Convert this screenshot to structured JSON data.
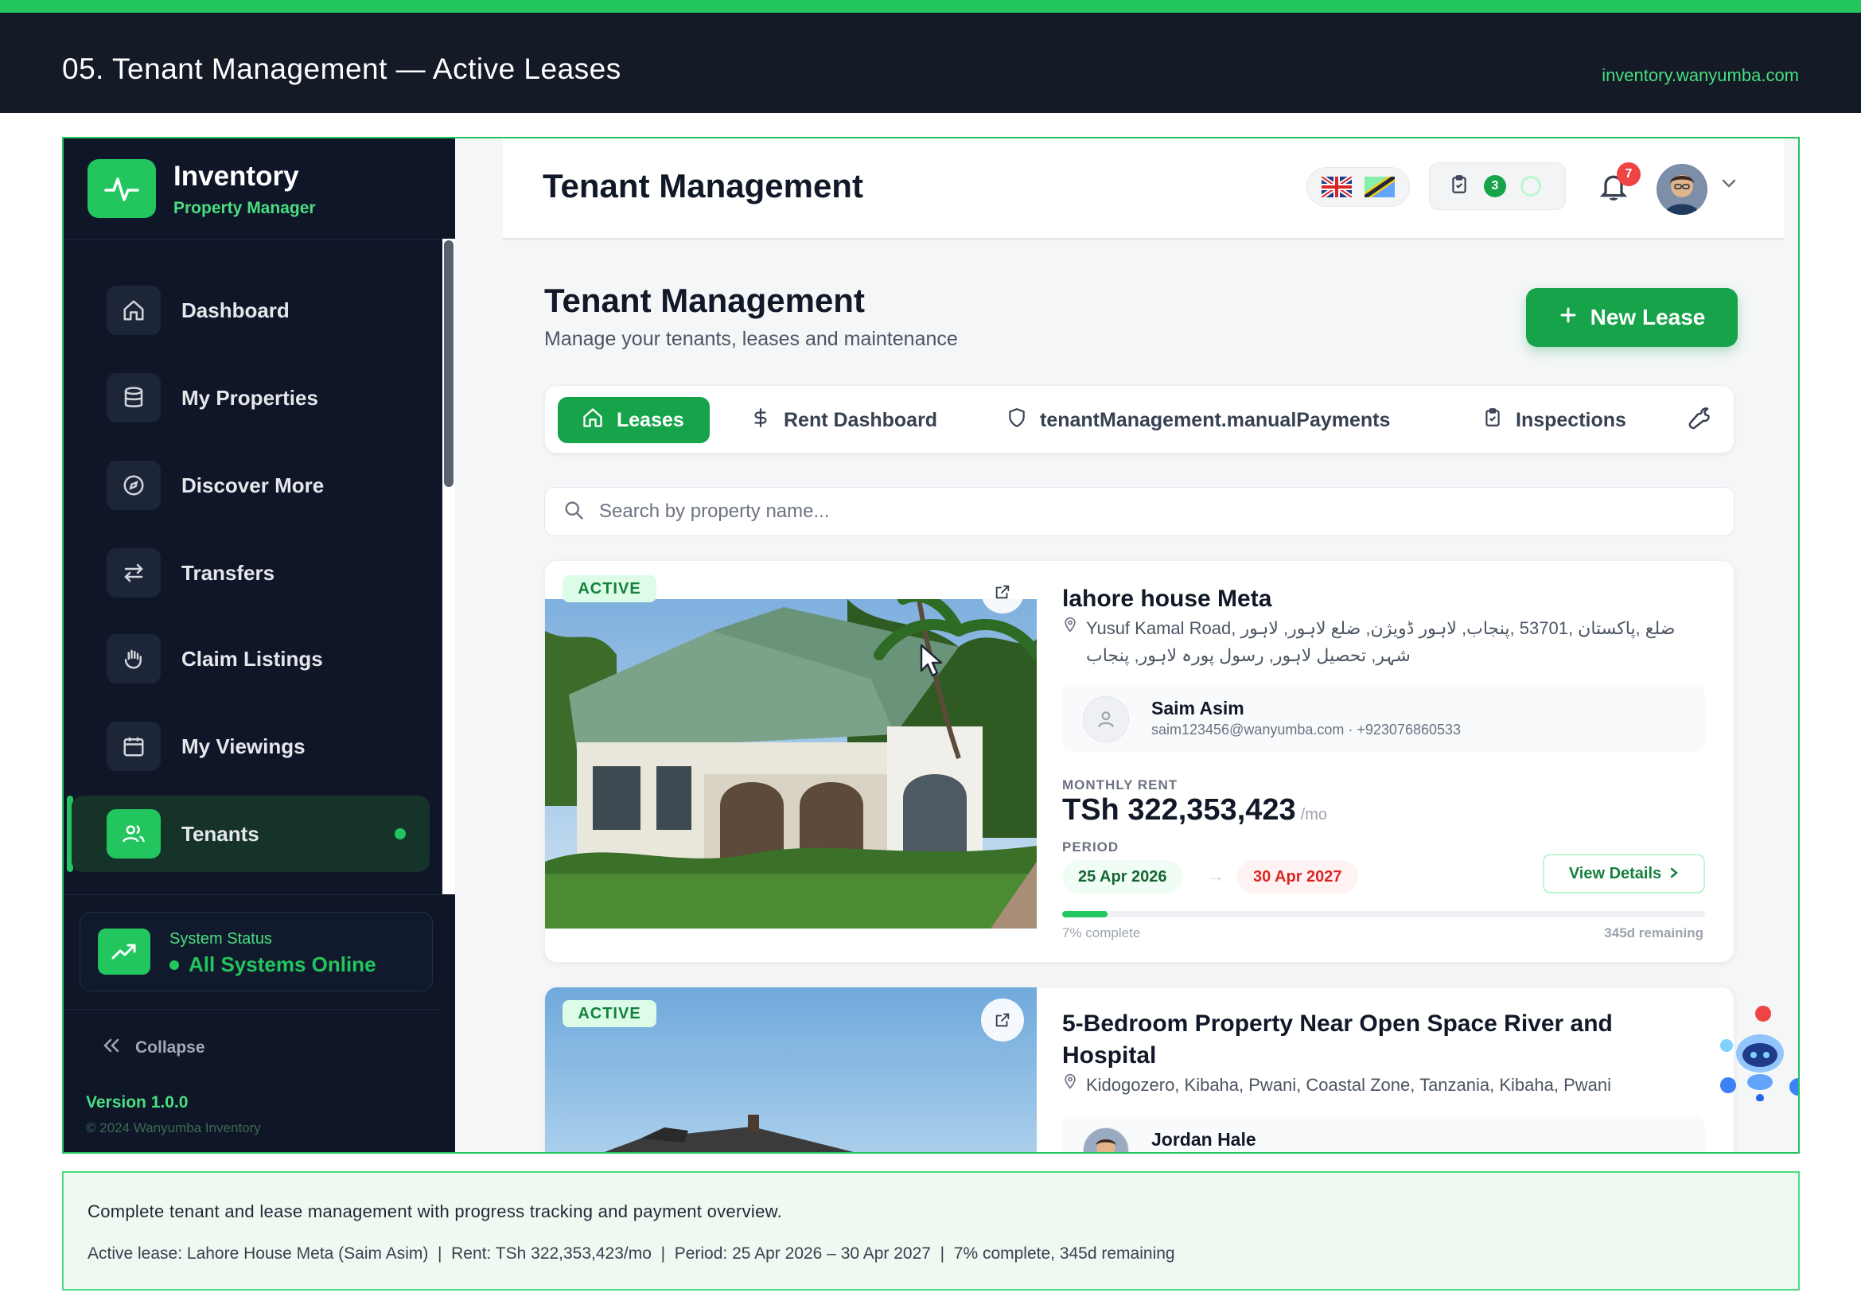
{
  "slide": {
    "title": "05. Tenant Management — Active Leases",
    "url": "inventory.wanyumba.com"
  },
  "sidebar": {
    "brand_name": "Inventory",
    "brand_sub": "Property Manager",
    "items": [
      {
        "label": "Dashboard",
        "icon": "home-icon"
      },
      {
        "label": "My Properties",
        "icon": "database-icon"
      },
      {
        "label": "Discover More",
        "icon": "compass-icon"
      },
      {
        "label": "Transfers",
        "icon": "transfer-arrows-icon"
      },
      {
        "label": "Claim Listings",
        "icon": "hand-icon"
      },
      {
        "label": "My Viewings",
        "icon": "calendar-icon"
      },
      {
        "label": "Tenants",
        "icon": "users-icon",
        "active": true
      }
    ],
    "status_title": "System Status",
    "status_value": "All Systems Online",
    "collapse_label": "Collapse",
    "version": "Version 1.0.0",
    "copyright": "© 2024 Wanyumba Inventory"
  },
  "header": {
    "title": "Tenant Management",
    "task_count": "3",
    "notification_count": "7"
  },
  "page": {
    "title": "Tenant Management",
    "subtitle": "Manage your tenants, leases and maintenance",
    "new_lease_label": "New Lease",
    "tabs": [
      {
        "label": "Leases",
        "icon": "home-icon"
      },
      {
        "label": "Rent Dashboard",
        "icon": "dollar-icon"
      },
      {
        "label": "tenantManagement.manualPayments",
        "icon": "shield-icon"
      },
      {
        "label": "Inspections",
        "icon": "clipboard-icon"
      }
    ],
    "search_placeholder": "Search by property name..."
  },
  "leases": [
    {
      "status": "ACTIVE",
      "name": "lahore house Meta",
      "address": "Yusuf Kamal Road, ضلع ,پاکستان ,53701 ,پنجاب, لاہور ڈویژن, ضلع لاہور, لاہور شہر, تحصیل لاہور, رسول پورہ لاہور, پنجاب",
      "tenant_name": "Saim Asim",
      "tenant_contact": "saim123456@wanyumba.com · +923076860533",
      "rent_label": "MONTHLY RENT",
      "rent": "TSh 322,353,423",
      "rent_unit": "/mo",
      "period_label": "PERIOD",
      "start": "25 Apr 2026",
      "end": "30 Apr 2027",
      "view_label": "View Details",
      "progress": 0.07,
      "progress_text": "7% complete",
      "remaining": "345d remaining"
    },
    {
      "status": "ACTIVE",
      "name": "5-Bedroom Property Near Open Space River and Hospital",
      "address": "Kidogozero, Kibaha, Pwani, Coastal Zone, Tanzania, Kibaha, Pwani",
      "tenant_name": "Jordan Hale"
    }
  ],
  "footer": {
    "line1": "Complete tenant and lease management with progress tracking and payment overview.",
    "line2": "Active lease: Lahore House Meta (Saim Asim)  |  Rent: TSh 322,353,423/mo  |  Period: 25 Apr 2026 – 30 Apr 2027  |  7% complete, 345d remaining"
  },
  "colors": {
    "accent": "#22c55e",
    "sidebar_bg": "#0e1628",
    "danger": "#ef4444"
  }
}
